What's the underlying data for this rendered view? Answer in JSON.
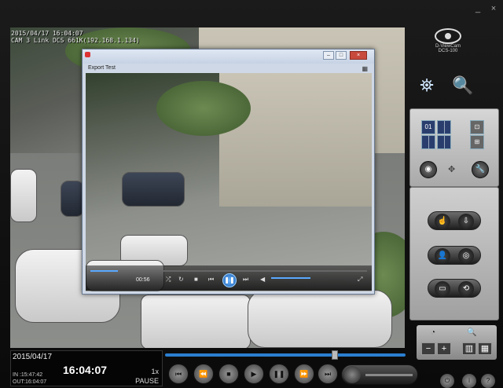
{
  "window_controls": {
    "minimize": "_",
    "close": "×"
  },
  "osd": {
    "datetime": "2015/04/17 16:04:07",
    "camera": "CAM 3 Link DCS 661K(192.168.1.134)"
  },
  "logo": {
    "brand": "D-ViewCam",
    "sub": "DCS-100"
  },
  "export_window": {
    "title": "Export Test",
    "time": "00:56",
    "progress": 0.1,
    "controls": {
      "play": "❚❚"
    },
    "wbtns": {
      "min": "–",
      "max": "□",
      "close": "×"
    }
  },
  "right_panel": {
    "grid_single": "01"
  },
  "status": {
    "date": "2015/04/17",
    "in_label": "IN :15:47:42",
    "out_label": "OUT:16:04:07",
    "clock": "16:04:07",
    "speed": "1x",
    "mode": "PAUSE"
  },
  "timeline": {
    "position": 0.71
  },
  "zoom": {
    "minus": "−",
    "plus": "+"
  },
  "colors": {
    "accent": "#2a7fd0",
    "play": "#1b5fb3"
  }
}
